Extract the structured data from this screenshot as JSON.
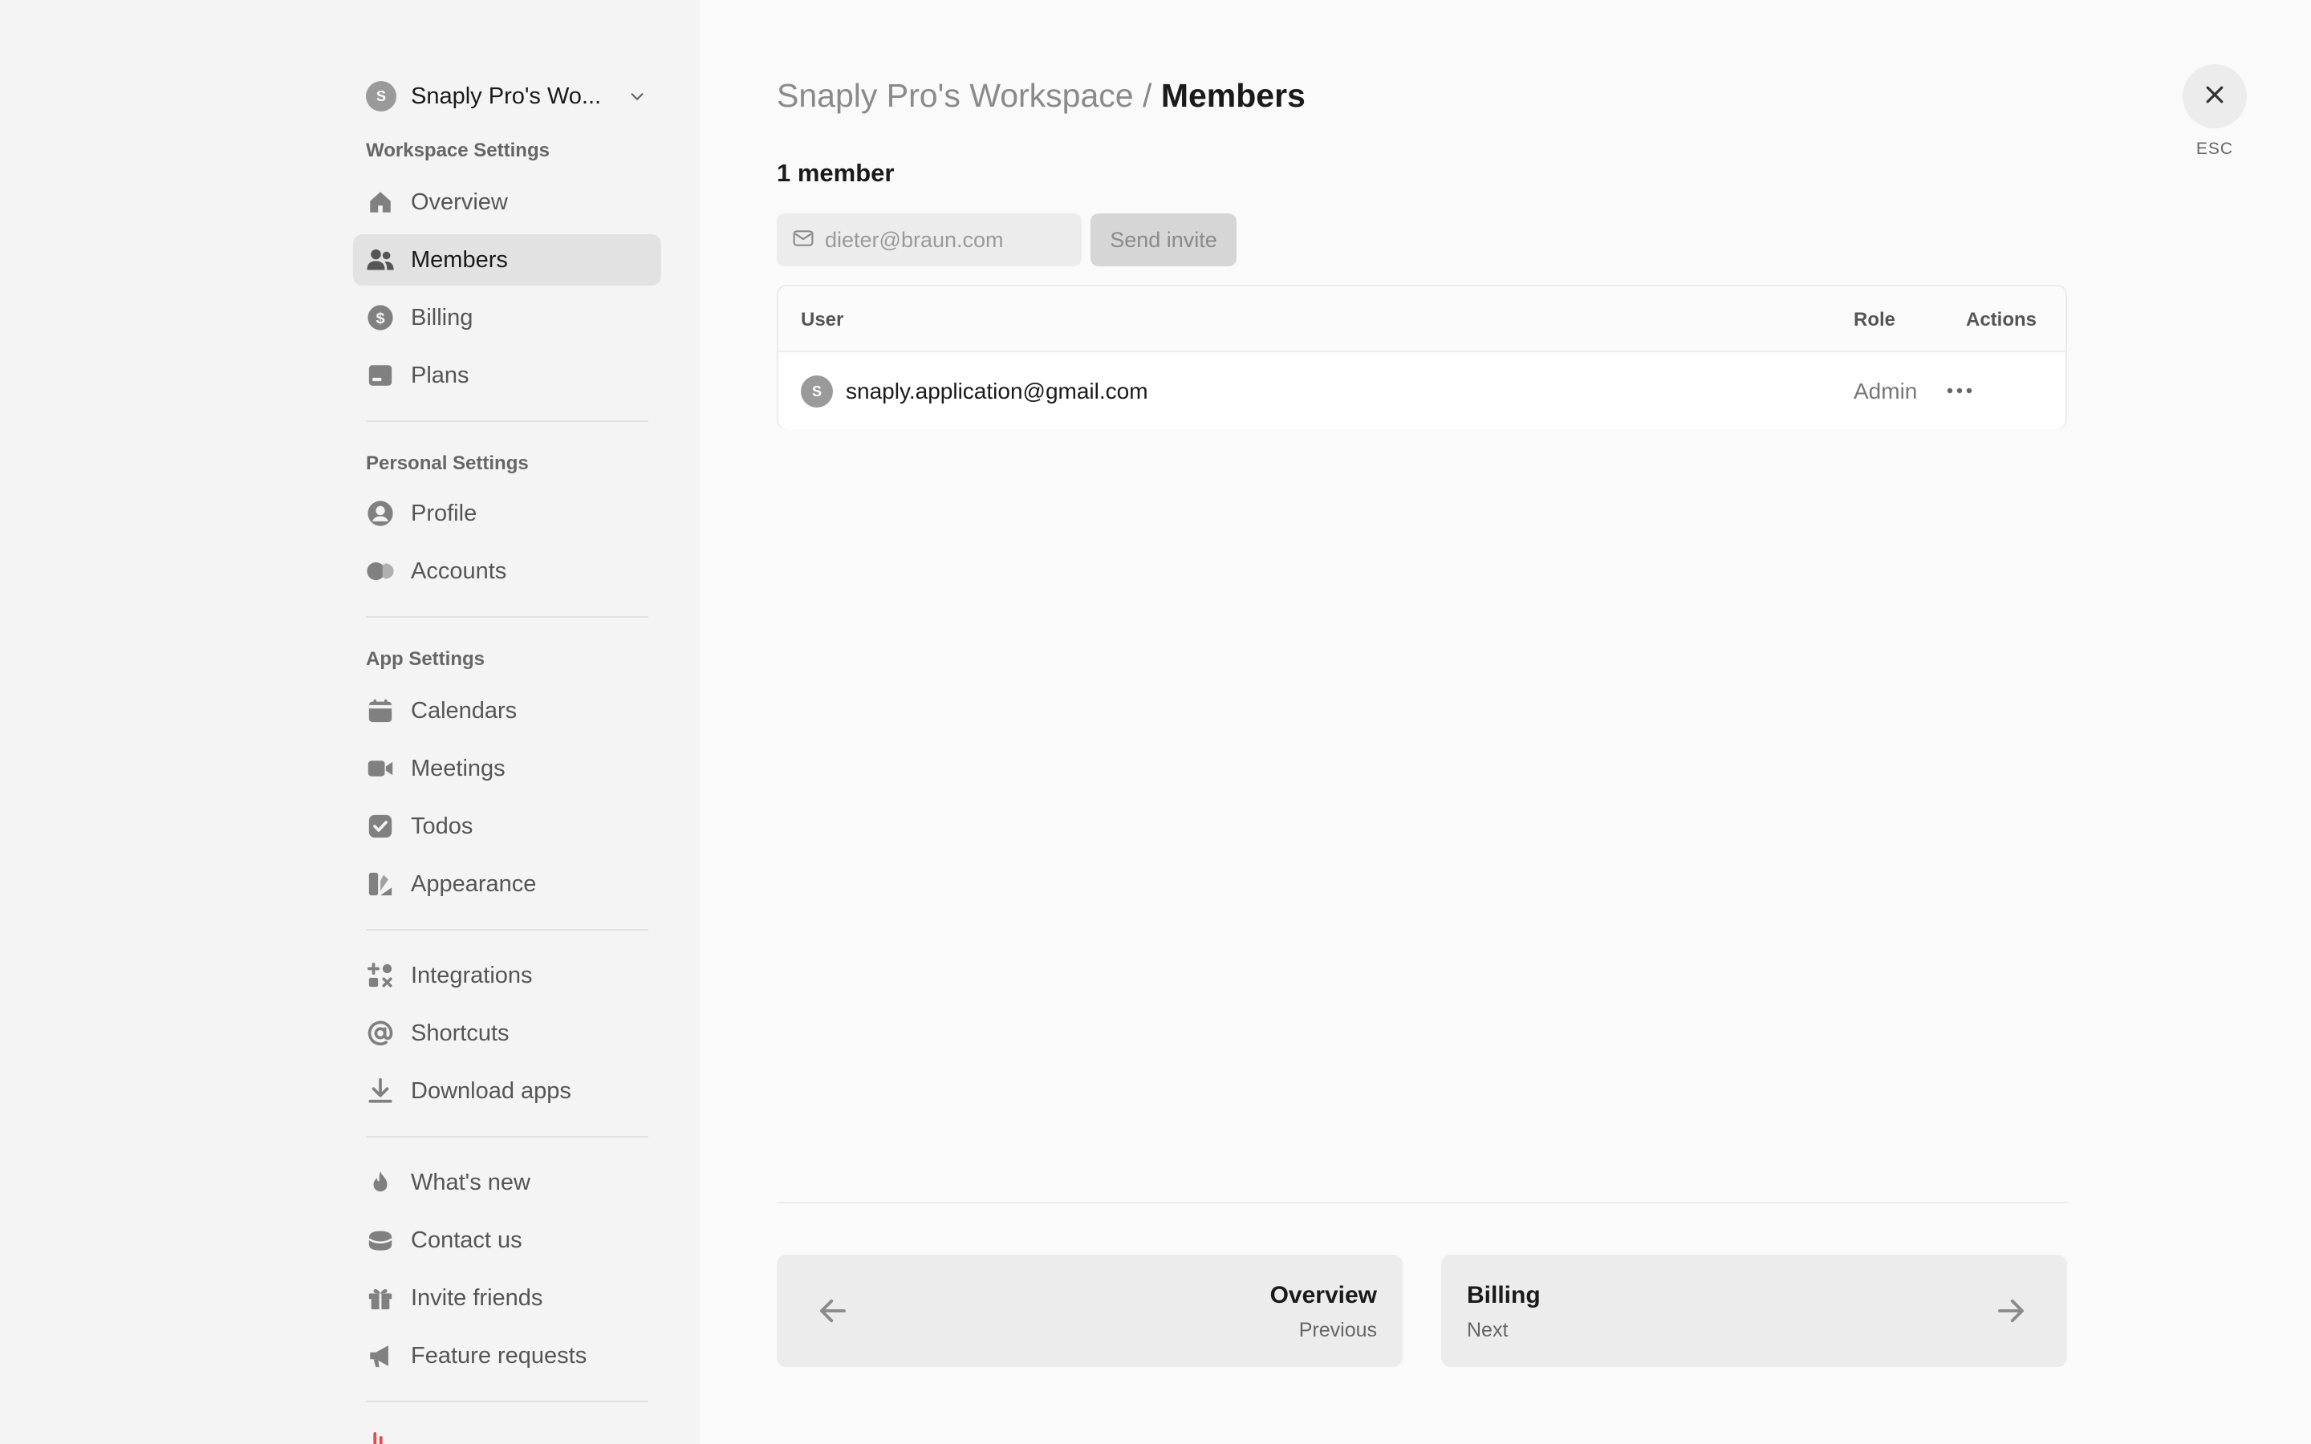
{
  "workspace": {
    "avatar_letter": "S",
    "name": "Snaply Pro's Wo..."
  },
  "sidebar": {
    "workspace_settings_label": "Workspace Settings",
    "personal_settings_label": "Personal Settings",
    "app_settings_label": "App Settings",
    "items": {
      "overview": "Overview",
      "members": "Members",
      "billing": "Billing",
      "plans": "Plans",
      "profile": "Profile",
      "accounts": "Accounts",
      "calendars": "Calendars",
      "meetings": "Meetings",
      "todos": "Todos",
      "appearance": "Appearance",
      "integrations": "Integrations",
      "shortcuts": "Shortcuts",
      "download_apps": "Download apps",
      "whats_new": "What's new",
      "contact_us": "Contact us",
      "invite_friends": "Invite friends",
      "feature_requests": "Feature requests"
    },
    "active": "members",
    "logout_color": "#e5484d"
  },
  "main": {
    "breadcrumb": {
      "workspace": "Snaply Pro's Workspace",
      "separator": "/",
      "current": "Members"
    },
    "member_count": "1 member",
    "invite": {
      "placeholder": "dieter@braun.com",
      "value": "",
      "button_label": "Send invite"
    },
    "table": {
      "headers": {
        "user": "User",
        "role": "Role",
        "actions": "Actions"
      },
      "rows": [
        {
          "avatar_letter": "S",
          "email": "snaply.application@gmail.com",
          "role": "Admin"
        }
      ]
    },
    "close": {
      "label": "ESC"
    },
    "pager": {
      "prev": {
        "title": "Overview",
        "sub": "Previous"
      },
      "next": {
        "title": "Billing",
        "sub": "Next"
      }
    }
  },
  "icons": {
    "overview": "home-icon",
    "members": "users-icon",
    "billing": "dollar-icon",
    "plans": "card-icon",
    "profile": "user-circle-icon",
    "accounts": "toggle-icon",
    "calendars": "calendar-icon",
    "meetings": "video-icon",
    "todos": "checkbox-icon",
    "appearance": "palette-icon",
    "integrations": "integrations-icon",
    "shortcuts": "at-icon",
    "download_apps": "download-icon",
    "whats_new": "flame-icon",
    "contact_us": "inbox-icon",
    "invite_friends": "gift-icon",
    "feature_requests": "megaphone-icon"
  }
}
